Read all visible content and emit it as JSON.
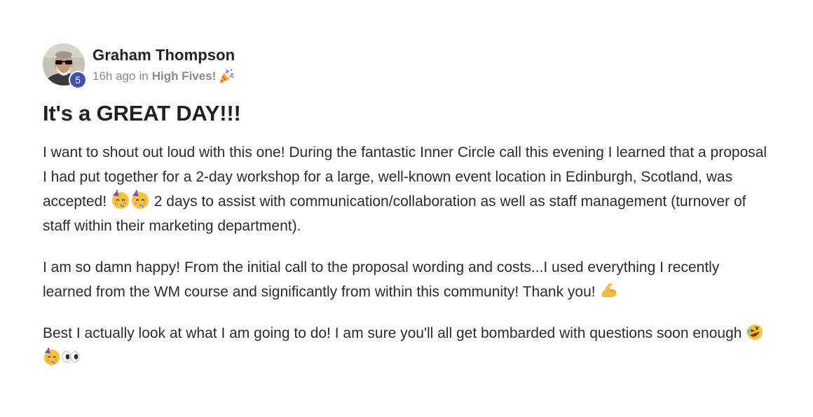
{
  "post": {
    "author": "Graham Thompson",
    "level": "5",
    "time": "16h ago",
    "in_label": "in",
    "category": "High Fives!",
    "category_icon": "party-popper-icon",
    "title": "It's a GREAT DAY!!!",
    "p1_a": "I want to shout out loud with this one! During the fantastic Inner Circle call this evening I learned that a proposal I had put together for a 2-day workshop for a large, well-known event location in Edinburgh, Scotland, was accepted!",
    "p1_b": "2 days to assist with communication/collaboration as well as staff management (turnover of staff within their marketing department).",
    "p2": "I am so damn happy! From the initial call to the proposal wording and costs...I used everything I recently learned from the WM course and significantly from within this community! Thank you!",
    "p3": "Best I actually look at what I am going to do! I am sure you'll all get bombarded with questions soon enough"
  },
  "colors": {
    "badge": "#3f51b5",
    "meta_text": "#8a8a8a",
    "text": "#202124"
  }
}
